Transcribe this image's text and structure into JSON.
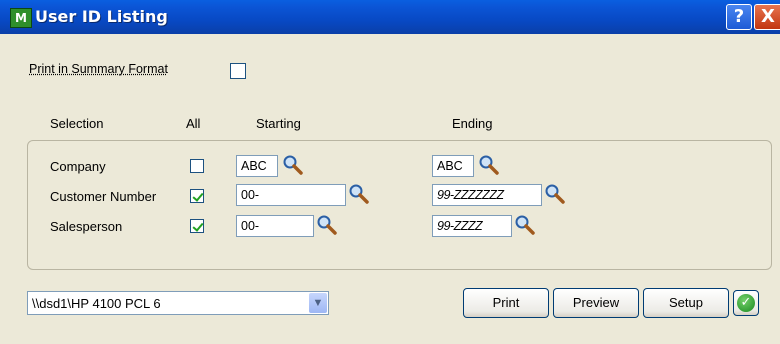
{
  "window": {
    "title": "User ID Listing",
    "app_icon_glyph": "M",
    "help_glyph": "?",
    "close_glyph": "X"
  },
  "options": {
    "summary_label": "Print in Summary Format",
    "summary_checked": false
  },
  "headers": {
    "selection": "Selection",
    "all": "All",
    "starting": "Starting",
    "ending": "Ending"
  },
  "rows": [
    {
      "label": "Company",
      "all_checked": false,
      "starting": "ABC",
      "ending": "ABC"
    },
    {
      "label": "Customer Number",
      "all_checked": true,
      "starting": "00-",
      "ending": "99-ZZZZZZZ"
    },
    {
      "label": "Salesperson",
      "all_checked": true,
      "starting": "00-",
      "ending": "99-ZZZZ"
    }
  ],
  "printer": {
    "selected": "\\\\dsd1\\HP 4100 PCL 6"
  },
  "buttons": {
    "print": "Print",
    "preview": "Preview",
    "setup": "Setup"
  },
  "icons": {
    "lookup": "magnifier-icon",
    "ok": "checkmark-circle-icon"
  },
  "colors": {
    "titlebar": "#0a50d0",
    "background": "#ece9d8",
    "check_mark": "#21a121"
  }
}
